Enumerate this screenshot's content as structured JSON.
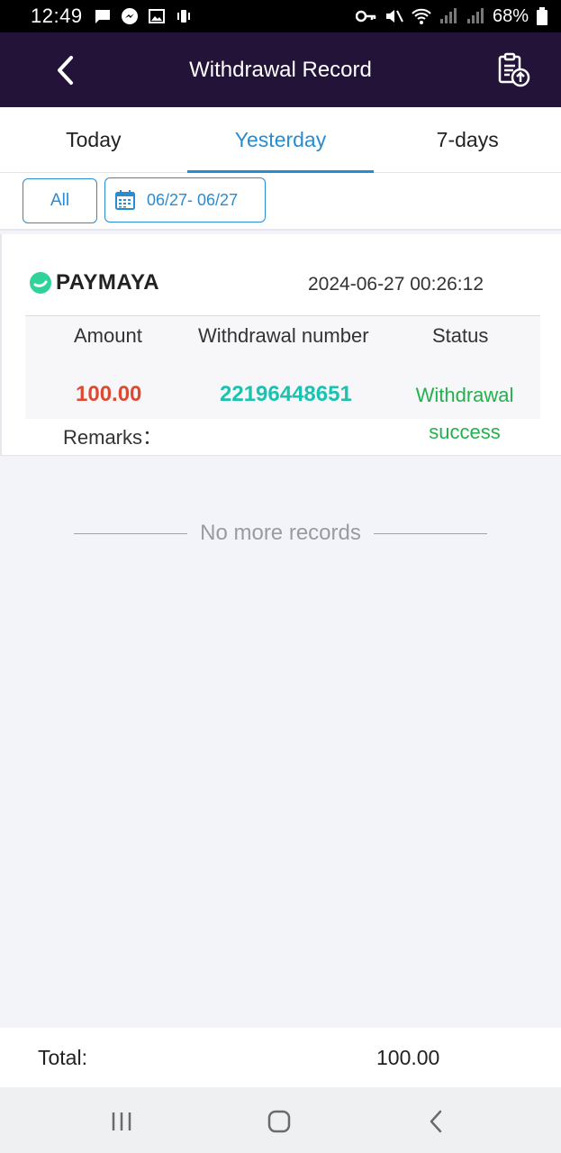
{
  "status_bar": {
    "time": "12:49",
    "battery_percent": "68%"
  },
  "header": {
    "title": "Withdrawal Record"
  },
  "tabs": [
    {
      "label": "Today",
      "active": false
    },
    {
      "label": "Yesterday",
      "active": true
    },
    {
      "label": "7-days",
      "active": false
    }
  ],
  "filters": {
    "all_label": "All",
    "date_range": "06/27- 06/27"
  },
  "record": {
    "provider": "PAYMAYA",
    "datetime": "2024-06-27 00:26:12",
    "columns": [
      "Amount",
      "Withdrawal number",
      "Status"
    ],
    "amount": "100.00",
    "withdrawal_number": "22196448651",
    "status_line1": "Withdrawal",
    "status_line2": "success",
    "remarks_label": "Remarks："
  },
  "no_more": "No more records",
  "total": {
    "label": "Total:",
    "value": "100.00"
  },
  "colors": {
    "header_bg": "#231339",
    "accent": "#2a8cd0",
    "amount": "#dd4a34",
    "withdrawal_number": "#19c3b0",
    "status": "#22b14c"
  }
}
